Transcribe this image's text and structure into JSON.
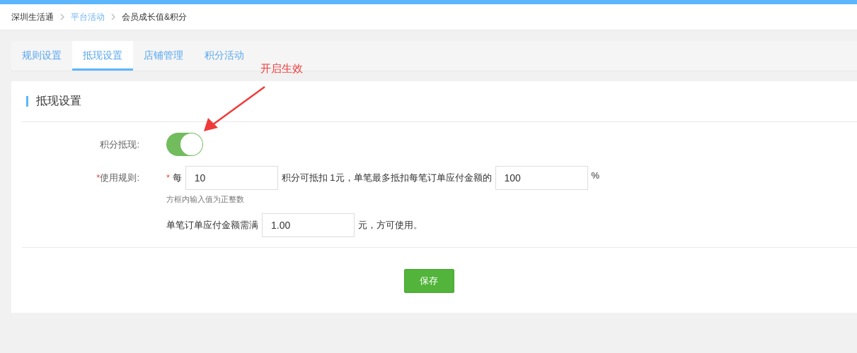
{
  "breadcrumb": [
    {
      "label": "深圳生活通",
      "kind": "text"
    },
    {
      "label": "平台活动",
      "kind": "link"
    },
    {
      "label": "会员成长值&积分",
      "kind": "text"
    }
  ],
  "tabs": [
    {
      "label": "规则设置",
      "selected": false
    },
    {
      "label": "抵现设置",
      "selected": true
    },
    {
      "label": "店铺管理",
      "selected": false
    },
    {
      "label": "积分活动",
      "selected": false
    }
  ],
  "annotation": {
    "text": "开启生效"
  },
  "section": {
    "title": "抵现设置",
    "toggle": {
      "label": "积分抵现:",
      "on": true
    },
    "rule": {
      "label": "使用规则:",
      "required_mark": "*",
      "inline_mark": "*",
      "prefix": "每",
      "points": "10",
      "middle": "积分可抵扣 1元，单笔最多抵扣每笔订单应付金额的",
      "percent": "100",
      "suffix": "%",
      "hint": "方框内输入值为正整数",
      "min_label": "单笔订单应付金额需满",
      "min_amount": "1.00",
      "min_suffix": "元，方可使用。"
    }
  },
  "save_button": "保存"
}
